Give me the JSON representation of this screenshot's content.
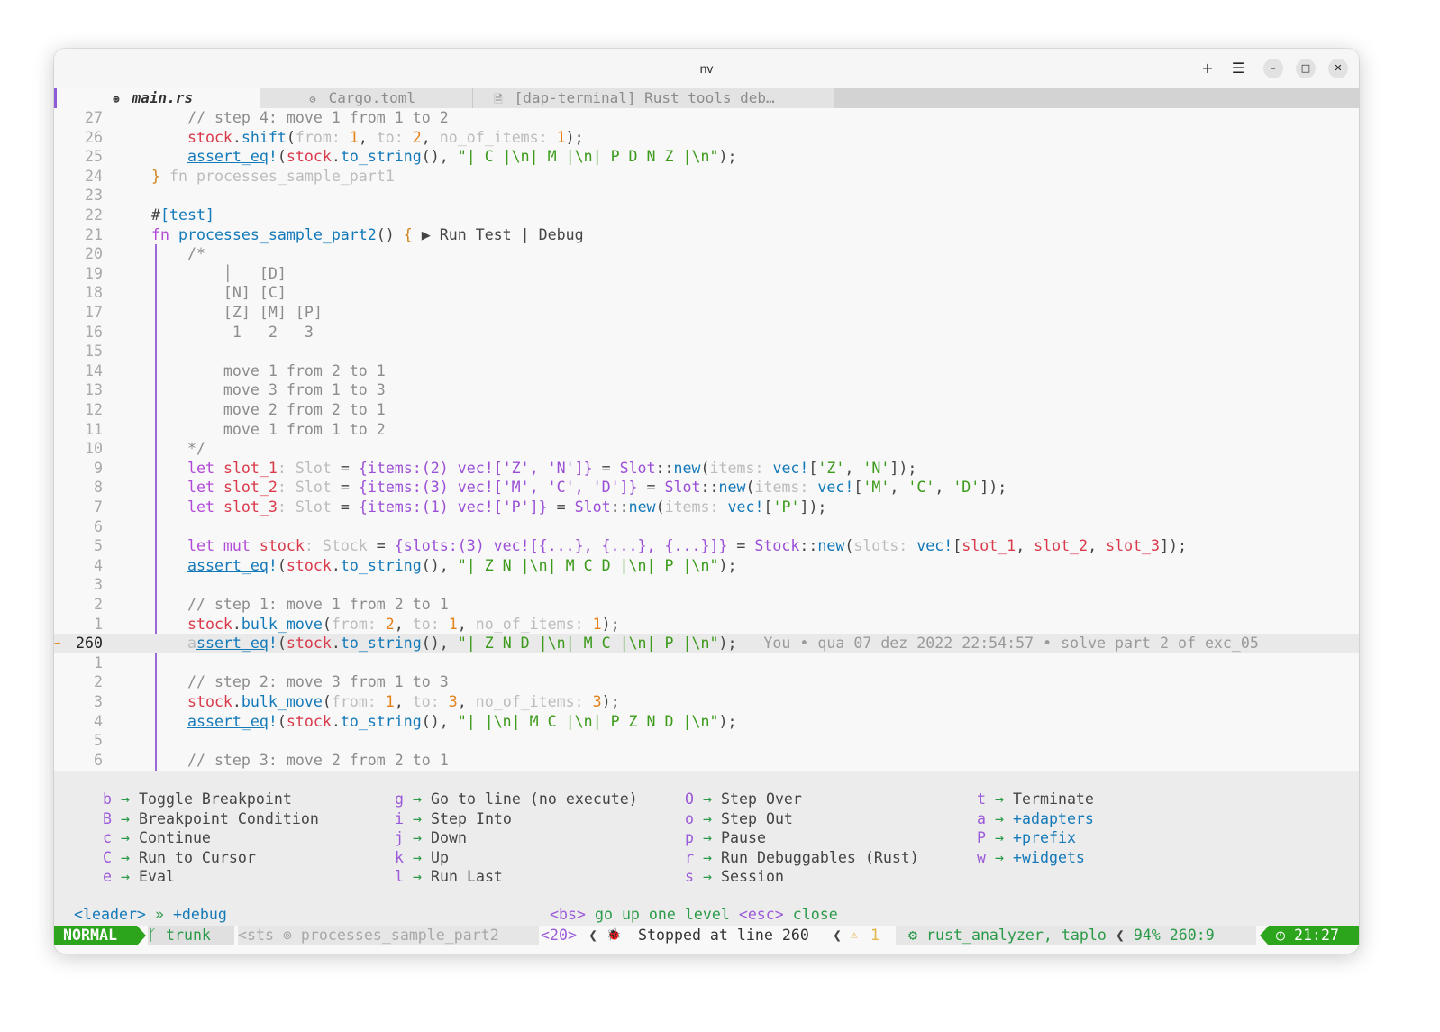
{
  "window": {
    "title": "nv"
  },
  "titlebar_buttons": {
    "add": "+",
    "menu": "☰",
    "minimize": "–",
    "maximize": "□",
    "close": "✕"
  },
  "tabs": [
    {
      "icon": "⊛",
      "label": "main.rs"
    },
    {
      "icon": "⚙",
      "label": "Cargo.toml"
    },
    {
      "icon": "🗎",
      "label": "[dap-terminal] Rust tools deb…"
    }
  ],
  "code_lines": [
    {
      "ln": "27",
      "html": "    <span class='cm'>// step 4: move 1 from 1 to 2</span>"
    },
    {
      "ln": "26",
      "html": "    <span class='va'>stock</span>.<span class='fn'>shift</span><span class='pu'>(</span><span class='hi'>from: </span><span class='nu'>1</span>, <span class='hi'>to: </span><span class='nu'>2</span>, <span class='hi'>no_of_items: </span><span class='nu'>1</span><span class='pu'>);</span>"
    },
    {
      "ln": "25",
      "html": "    <span class='fn ul'>assert_eq</span><span class='fn'>!</span>(<span class='va'>stock</span>.<span class='fn'>to_string</span>(), <span class='st'>\"| C |\\n| M |\\n| P D N Z |\\n\"</span>);"
    },
    {
      "ln": "24",
      "html": "<span class='br'>}</span> <span class='hi'>fn processes_sample_part1</span>"
    },
    {
      "ln": "23",
      "html": ""
    },
    {
      "ln": "22",
      "html": "#<span class='fn'>[test]</span>"
    },
    {
      "ln": "21",
      "html": "<span class='kw'>fn</span> <span class='fn'>processes_sample_part2</span>() <span class='br'>{</span> ▶ Run Test | Debug"
    },
    {
      "ln": "20",
      "html": "    <span class='cm'>/*</span>"
    },
    {
      "ln": "19",
      "html": "    <span class='cm'>    │   [D]</span>"
    },
    {
      "ln": "18",
      "html": "    <span class='cm'>    [N] [C]</span>"
    },
    {
      "ln": "17",
      "html": "    <span class='cm'>    [Z] [M] [P]</span>"
    },
    {
      "ln": "16",
      "html": "    <span class='cm'>     1   2   3</span>"
    },
    {
      "ln": "15",
      "html": ""
    },
    {
      "ln": "14",
      "html": "    <span class='cm'>    move 1 from 2 to 1</span>"
    },
    {
      "ln": "13",
      "html": "    <span class='cm'>    move 3 from 1 to 3</span>"
    },
    {
      "ln": "12",
      "html": "    <span class='cm'>    move 2 from 2 to 1</span>"
    },
    {
      "ln": "11",
      "html": "    <span class='cm'>    move 1 from 1 to 2</span>"
    },
    {
      "ln": "10",
      "html": "    <span class='cm'>*/</span>"
    },
    {
      "ln": "9",
      "html": "    <span class='kw'>let</span> <span class='va'>slot_1</span><span class='hi'>: Slot</span> = <span class='ty'>{items:(2) vec!['Z', 'N']}</span> = <span class='ty'>Slot</span>::<span class='fn'>new</span>(<span class='hi'>items: </span><span class='fn'>vec!</span>[<span class='st'>'Z'</span>, <span class='st'>'N'</span>]);"
    },
    {
      "ln": "8",
      "html": "    <span class='kw'>let</span> <span class='va'>slot_2</span><span class='hi'>: Slot</span> = <span class='ty'>{items:(3) vec!['M', 'C', 'D']}</span> = <span class='ty'>Slot</span>::<span class='fn'>new</span>(<span class='hi'>items: </span><span class='fn'>vec!</span>[<span class='st'>'M'</span>, <span class='st'>'C'</span>, <span class='st'>'D'</span>]);"
    },
    {
      "ln": "7",
      "html": "    <span class='kw'>let</span> <span class='va'>slot_3</span><span class='hi'>: Slot</span> = <span class='ty'>{items:(1) vec!['P']}</span> = <span class='ty'>Slot</span>::<span class='fn'>new</span>(<span class='hi'>items: </span><span class='fn'>vec!</span>[<span class='st'>'P'</span>]);"
    },
    {
      "ln": "6",
      "html": ""
    },
    {
      "ln": "5",
      "html": "    <span class='kw'>let mut</span> <span class='va'>stock</span><span class='hi'>: Stock</span> = <span class='ty'>{slots:(3) vec![{...}, {...}, {...}]}</span> = <span class='ty'>Stock</span>::<span class='fn'>new</span>(<span class='hi'>slots: </span><span class='fn'>vec!</span>[<span class='va'>slot_1</span>, <span class='va'>slot_2</span>, <span class='va'>slot_3</span>]);"
    },
    {
      "ln": "4",
      "html": "    <span class='fn ul'>assert_eq</span><span class='fn'>!</span>(<span class='va'>stock</span>.<span class='fn'>to_string</span>(), <span class='st'>\"| Z N |\\n| M C D |\\n| P |\\n\"</span>);"
    },
    {
      "ln": "3",
      "html": ""
    },
    {
      "ln": "2",
      "html": "    <span class='cm'>// step 1: move 1 from 2 to 1</span>"
    },
    {
      "ln": "1",
      "html": "    <span class='va'>stock</span>.<span class='fn'>bulk_move</span>(<span class='hi'>from: </span><span class='nu'>2</span>, <span class='hi'>to: </span><span class='nu'>1</span>, <span class='hi'>no_of_items: </span><span class='nu'>1</span>);"
    },
    {
      "ln": "260",
      "current": true,
      "html": "    <span class='hi'>a</span><span class='fn ul'>ssert_eq</span><span class='fn'>!</span>(<span class='va'>stock</span>.<span class='fn'>to_string</span>(), <span class='st'>\"| Z N D |\\n| M C |\\n| P |\\n\"</span>);   <span class='blm'>You • qua 07 dez 2022 22:54:57 • solve part 2 of exc_05</span>"
    },
    {
      "ln": "1",
      "html": ""
    },
    {
      "ln": "2",
      "html": "    <span class='cm'>// step 2: move 3 from 1 to 3</span>"
    },
    {
      "ln": "3",
      "html": "    <span class='va'>stock</span>.<span class='fn'>bulk_move</span>(<span class='hi'>from: </span><span class='nu'>1</span>, <span class='hi'>to: </span><span class='nu'>3</span>, <span class='hi'>no_of_items: </span><span class='nu'>3</span>);"
    },
    {
      "ln": "4",
      "html": "    <span class='fn ul'>assert_eq</span><span class='fn'>!</span>(<span class='va'>stock</span>.<span class='fn'>to_string</span>(), <span class='st'>\"| |\\n| M C |\\n| P Z N D |\\n\"</span>);"
    },
    {
      "ln": "5",
      "html": ""
    },
    {
      "ln": "6",
      "html": "    <span class='cm'>// step 3: move 2 from 2 to 1</span>"
    }
  ],
  "current_line_arrow": "→",
  "which_key": {
    "columns": [
      [
        {
          "key": "b",
          "label": "Toggle Breakpoint"
        },
        {
          "key": "B",
          "label": "Breakpoint Condition"
        },
        {
          "key": "c",
          "label": "Continue"
        },
        {
          "key": "C",
          "label": "Run to Cursor"
        },
        {
          "key": "e",
          "label": "Eval"
        }
      ],
      [
        {
          "key": "g",
          "label": "Go to line (no execute)"
        },
        {
          "key": "i",
          "label": "Step Into"
        },
        {
          "key": "j",
          "label": "Down"
        },
        {
          "key": "k",
          "label": "Up"
        },
        {
          "key": "l",
          "label": "Run Last"
        }
      ],
      [
        {
          "key": "O",
          "label": "Step Over"
        },
        {
          "key": "o",
          "label": "Step Out"
        },
        {
          "key": "p",
          "label": "Pause"
        },
        {
          "key": "r",
          "label": "Run Debuggables (Rust)"
        },
        {
          "key": "s",
          "label": "Session"
        }
      ],
      [
        {
          "key": "t",
          "label": "Terminate",
          "group": false
        },
        {
          "key": "a",
          "label": "+adapters",
          "group": true
        },
        {
          "key": "P",
          "label": "+prefix",
          "group": true
        },
        {
          "key": "w",
          "label": "+widgets",
          "group": true
        }
      ]
    ],
    "arrow": "→",
    "breadcrumb_leader": "<leader>",
    "breadcrumb_sep": "»",
    "breadcrumb_group": "+debug",
    "help_bs_key": "<bs>",
    "help_bs_text": "go up one level",
    "help_esc_key": "<esc>",
    "help_esc_text": "close"
  },
  "statusline": {
    "mode": "NORMAL",
    "branch_icon": "ᚴ",
    "branch": "trunk",
    "context": "<sts ⊚ processes_sample_part2",
    "count": "<20>",
    "sep": "❮",
    "bug_icon": "🐞",
    "dap_status": "Stopped at line 260",
    "warn_icon": "⚠",
    "warn_count": "1",
    "lsp_icon": "⚙",
    "lsp": "rust_analyzer, taplo",
    "progress": "94%",
    "position": "260:9",
    "clock_icon": "◷",
    "time": "21:27"
  },
  "colors": {
    "accent": "#9a6ad8",
    "status_green": "#2ca41c",
    "keyword": "#b24ad8",
    "function": "#1479b8",
    "string": "#3b9a1a"
  }
}
